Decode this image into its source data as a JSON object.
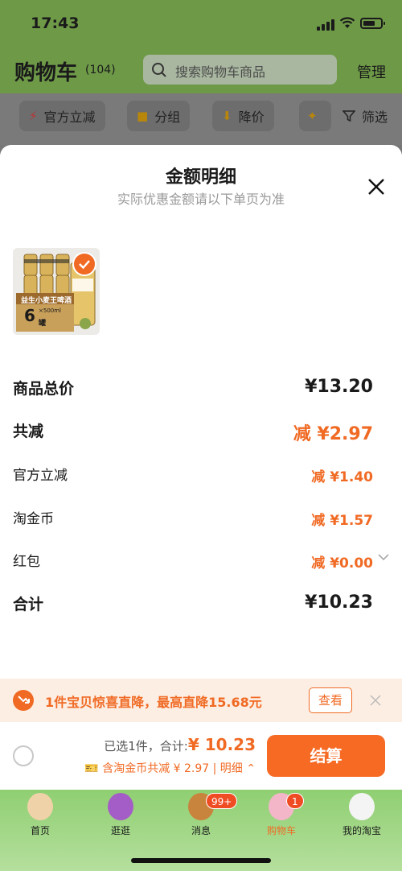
{
  "status_bar": {
    "time": "17:43"
  },
  "header": {
    "title": "购物车",
    "count": "(104)",
    "search_placeholder": "搜索购物车商品",
    "manage_label": "管理"
  },
  "filters": [
    {
      "label": "官方立减",
      "icon": "lightning-icon"
    },
    {
      "label": "分组",
      "icon": "folder-icon"
    },
    {
      "label": "降价",
      "icon": "price-drop-icon"
    },
    {
      "label": "",
      "icon": "kangaroo-icon"
    },
    {
      "label": "筛选",
      "icon": "filter-icon"
    }
  ],
  "sheet": {
    "title": "金额明细",
    "subtitle": "实际优惠金额请以下单页为准",
    "product": {
      "image_caption": "益生小麦王啤酒",
      "pack_count": "6",
      "pack_unit": "罐",
      "volume": "×500ml"
    },
    "rows": {
      "total_price": {
        "label": "商品总价",
        "value": "¥13.20"
      },
      "total_discount": {
        "label": "共减",
        "value": "减 ¥2.97"
      },
      "official_discount": {
        "label": "官方立减",
        "value": "减 ¥1.40"
      },
      "coins": {
        "label": "淘金币",
        "value": "减 ¥1.57"
      },
      "red_packet": {
        "label": "红包",
        "value": "减 ¥0.00"
      },
      "sum": {
        "label": "合计",
        "value": "¥10.23"
      }
    }
  },
  "promo": {
    "text": "1件宝贝惊喜直降，最高直降15.68元",
    "view_label": "查看"
  },
  "checkout": {
    "selected_text": "已选1件，合计:",
    "total": "¥ 10.23",
    "detail_text": "含淘金币共减 ¥ 2.97 | 明细",
    "pay_label": "结算"
  },
  "tabs": [
    {
      "label": "首页",
      "badge": ""
    },
    {
      "label": "逛逛",
      "badge": ""
    },
    {
      "label": "消息",
      "badge": "99+"
    },
    {
      "label": "购物车",
      "badge": "1"
    },
    {
      "label": "我的淘宝",
      "badge": ""
    }
  ],
  "colors": {
    "accent": "#f06a24",
    "tab_green": "#8fcf72"
  }
}
